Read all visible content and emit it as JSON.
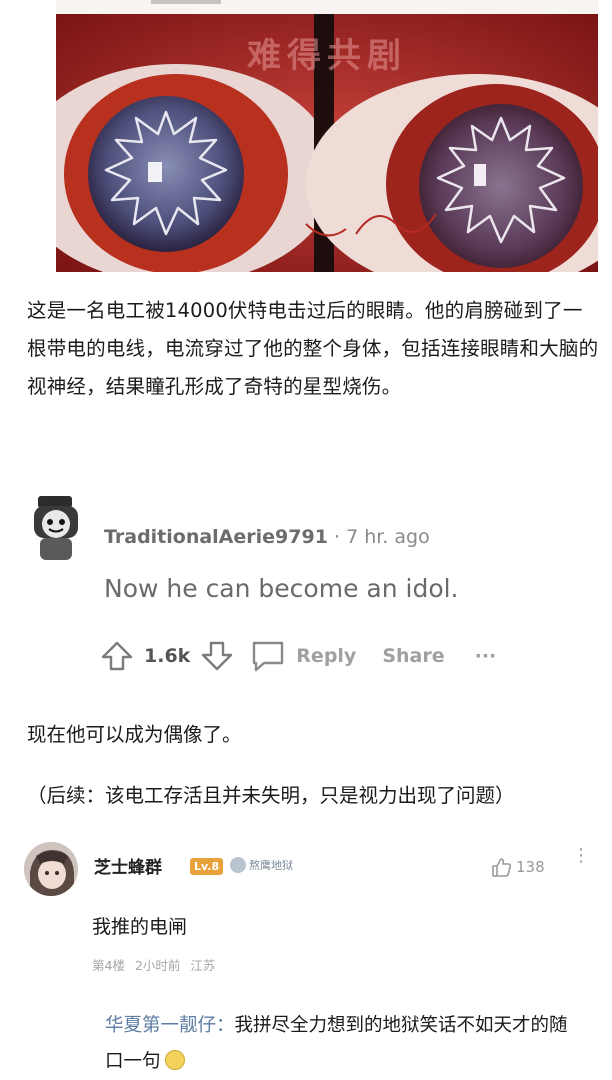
{
  "photo": {
    "caption": "难得共剧",
    "alt": "eyes-photo"
  },
  "post": {
    "body": "这是一名电工被14000伏特电击过后的眼睛。他的肩膀碰到了一根带电的电线，电流穿过了他的整个身体，包括连接眼睛和大脑的视神经，结果瞳孔形成了奇特的星型烧伤。"
  },
  "reddit": {
    "username": "TraditionalAerie9791",
    "separator": " · ",
    "time": "7 hr. ago",
    "comment": "Now he can become an idol.",
    "score": "1.6k",
    "reply_label": "Reply",
    "share_label": "Share",
    "more_label": "···"
  },
  "translation": "现在他可以成为偶像了。",
  "followup": "（后续：该电工存活且并未失明，只是视力出现了问题）",
  "weibo": {
    "username": "芝士蜂群",
    "level": "Lv.8",
    "badge": "熬鹰地狱",
    "likes": "138",
    "more_label": "⋮",
    "comment": "我推的电闸",
    "meta_floor": "第4楼",
    "meta_time": "2小时前",
    "meta_location": "江苏",
    "reply_name": "华夏第一靓仔：",
    "reply_text": "我拼尽全力想到的地狱笑话不如天才的随口一句"
  },
  "colors": {
    "text": "#1b1b1b",
    "muted": "#8a8a8a",
    "weibo_link": "#5d7ca3",
    "level_badge": "#e8a23c"
  }
}
